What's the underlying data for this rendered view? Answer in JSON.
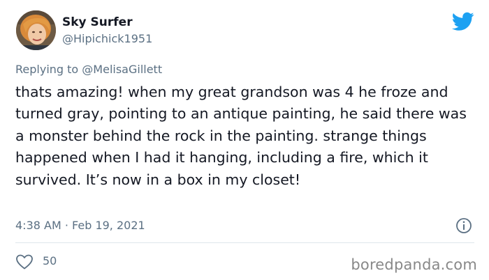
{
  "tweet": {
    "display_name": "Sky Surfer",
    "handle": "@Hipichick1951",
    "replying_prefix": "Replying to ",
    "replying_to": "@MelisaGillett",
    "text": "thats amazing! when my great grandson was 4 he froze and turned gray, pointing to an antique painting, he said there was a monster behind the rock in the painting. strange things happened when I had it hanging, including a fire, which it survived. It’s now in a box in my closet!",
    "timestamp": "4:38 AM · Feb 19, 2021",
    "like_count": "50"
  },
  "icons": {
    "brand": "twitter-bird-icon",
    "info": "info-icon",
    "like": "heart-icon"
  },
  "watermark": "boredpanda.com",
  "colors": {
    "twitter_blue": "#1da1f2",
    "text_primary": "#141823",
    "text_secondary": "#5b7083",
    "divider": "#dfe6ec"
  }
}
